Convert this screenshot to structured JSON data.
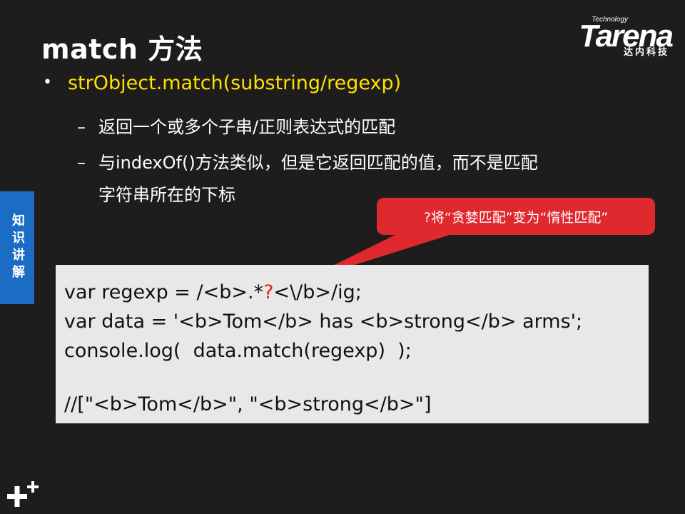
{
  "slide": {
    "title": "match 方法",
    "bullet": "strObject.match(substring/regexp)",
    "sub_items": [
      "返回一个或多个子串/正则表达式的匹配",
      "与indexOf()方法类似，但是它返回匹配的值，而不是匹配",
      "字符串所在的下标"
    ],
    "side_tab": "知识讲解",
    "callout": "?将“贪婪匹配”变为“惰性匹配”"
  },
  "logo": {
    "small": "Technology",
    "name": "Tarena",
    "cn": "达内科技"
  },
  "code": {
    "line1_a": "var regexp = /<b>.*",
    "line1_q": "?",
    "line1_b": "<\\/b>/ig;",
    "line2": "var data = '<b>Tom</b> has <b>strong</b> arms';",
    "line3": "console.log(  data.match(regexp)  );",
    "line5": "//[\"<b>Tom</b>\", \"<b>strong</b>\"]"
  },
  "colors": {
    "background": "#1e1c1d",
    "bullet_text": "#ffe100",
    "side_tab": "#1a6cc4",
    "callout": "#e0282f",
    "code_bg": "#e8e8e8"
  }
}
